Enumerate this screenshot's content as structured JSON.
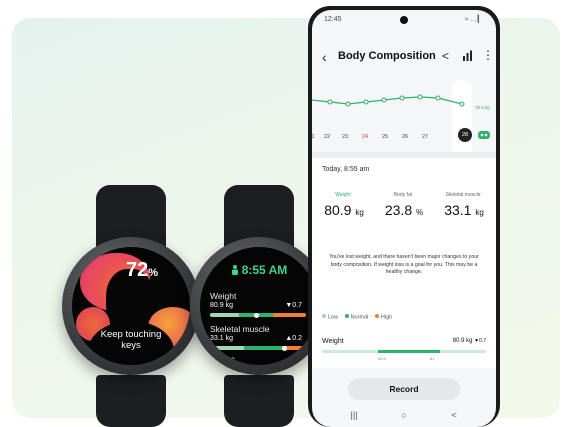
{
  "watch1": {
    "percent": "72",
    "percent_sign": "%",
    "caption_line1": "Keep touching",
    "caption_line2": "keys"
  },
  "watch2": {
    "time": "8:55 AM",
    "weight_label": "Weight",
    "weight_value": "80.9 kg",
    "weight_delta": "▼0.7",
    "muscle_label": "Skeletal muscle",
    "muscle_value": "33.1 kg",
    "muscle_delta": "▲0.2",
    "fat_mass_label": "t mass"
  },
  "phone": {
    "status_time": "12:45",
    "status_icons": "≈…▎",
    "title": "Body Composition",
    "trend_label": "79.5 kg",
    "dates": [
      "22",
      "23",
      "24",
      "25",
      "26",
      "27"
    ],
    "highlight_date": "24",
    "selected_date": "28",
    "partial_date_left": "1",
    "card": {
      "date": "Today, 8:55 am",
      "metrics": [
        {
          "label": "Weight",
          "value": "80.9",
          "unit": "kg"
        },
        {
          "label": "Body fat",
          "value": "23.8",
          "unit": "%"
        },
        {
          "label": "Skeletal muscle",
          "value": "33.1",
          "unit": "kg"
        }
      ],
      "message": "You've lost weight, and there haven't been major changes to your body composition. If weight loss is a goal for you. This may be a healthy change.",
      "legend": {
        "low": "Low",
        "normal": "Normal",
        "high": "High"
      },
      "weight_row_label": "Weight",
      "weight_row_value": "80.9 kg",
      "weight_row_delta": "▼0.7",
      "tick_1": "55.9",
      "tick_2": "81"
    },
    "record_label": "Record",
    "nav": {
      "recents": "|||",
      "home": "○",
      "back": "<"
    }
  },
  "colors": {
    "green": "#2bb36b",
    "orange": "#f0812f",
    "red": "#e03c31",
    "bg": "#e6f3ee"
  }
}
